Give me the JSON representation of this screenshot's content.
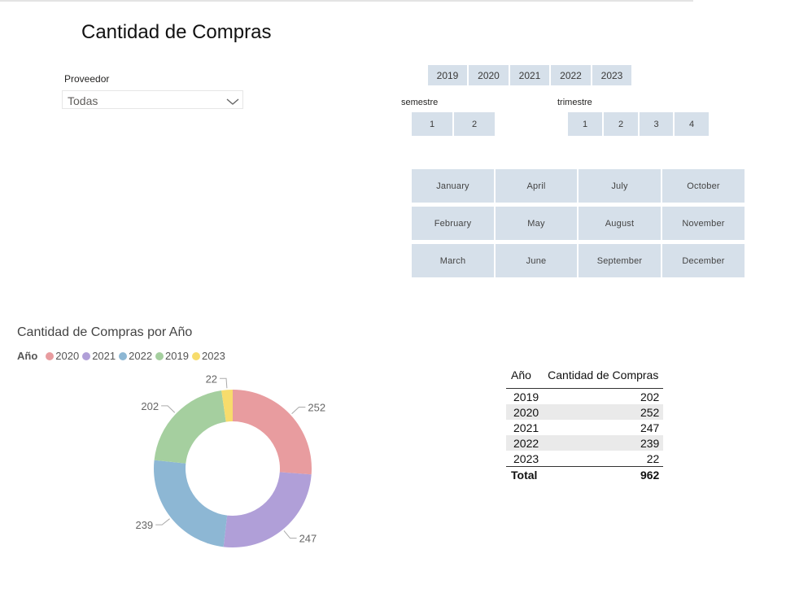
{
  "page_title": "Cantidad de Compras",
  "proveedor": {
    "label": "Proveedor",
    "selected": "Todas"
  },
  "years": [
    "2019",
    "2020",
    "2021",
    "2022",
    "2023"
  ],
  "semestre": {
    "label": "semestre",
    "options": [
      "1",
      "2"
    ]
  },
  "trimestre": {
    "label": "trimestre",
    "options": [
      "1",
      "2",
      "3",
      "4"
    ]
  },
  "months": {
    "col1": [
      "January",
      "February",
      "March"
    ],
    "col2": [
      "April",
      "May",
      "June"
    ],
    "col3": [
      "July",
      "August",
      "September"
    ],
    "col4": [
      "October",
      "November",
      "December"
    ]
  },
  "chart_data": {
    "type": "pie",
    "title": "Cantidad de Compras por Año",
    "legend_title": "Año",
    "legend_placement": "top-left",
    "donut": true,
    "slices": [
      {
        "label": "2020",
        "value": 252,
        "color": "#e89c9f"
      },
      {
        "label": "2021",
        "value": 247,
        "color": "#b09fd8"
      },
      {
        "label": "2022",
        "value": 239,
        "color": "#8db7d4"
      },
      {
        "label": "2019",
        "value": 202,
        "color": "#a5cf9f"
      },
      {
        "label": "2023",
        "value": 22,
        "color": "#f7dc6c"
      }
    ]
  },
  "table": {
    "headers": [
      "Año",
      "Cantidad de Compras"
    ],
    "rows": [
      [
        "2019",
        "202"
      ],
      [
        "2020",
        "252"
      ],
      [
        "2021",
        "247"
      ],
      [
        "2022",
        "239"
      ],
      [
        "2023",
        "22"
      ]
    ],
    "total": [
      "Total",
      "962"
    ]
  }
}
